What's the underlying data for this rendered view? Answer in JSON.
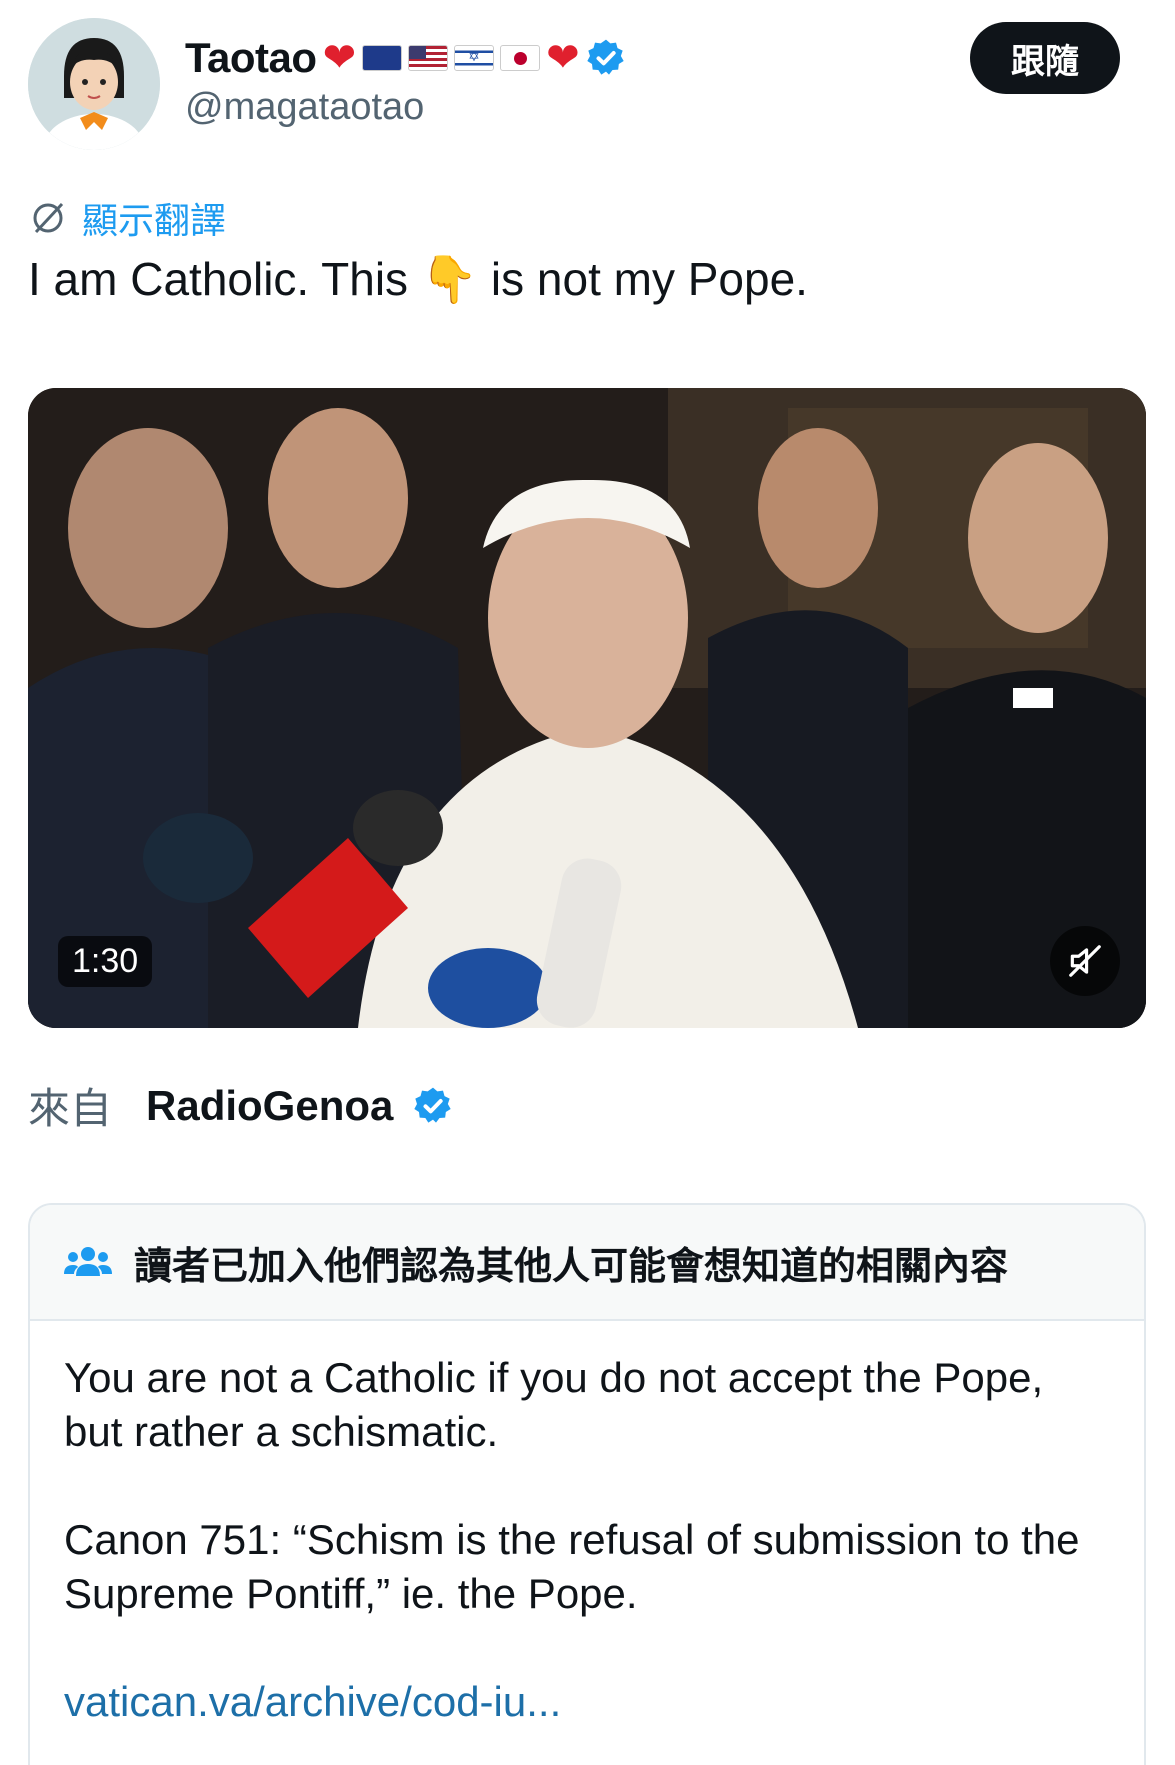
{
  "author": {
    "display_name": "Taotao",
    "handle": "@magataotao",
    "flags": [
      "australia-flag",
      "us-flag",
      "israel-flag",
      "japan-flag"
    ]
  },
  "follow_label": "跟隨",
  "translate_label": "顯示翻譯",
  "tweet_text_before": "I am Catholic. This ",
  "tweet_emoji": "👇",
  "tweet_text_after": " is not my Pope.",
  "video": {
    "duration": "1:30"
  },
  "source": {
    "label": "來自",
    "name": "RadioGenoa"
  },
  "note": {
    "header": "讀者已加入他們認為其他人可能會想知道的相關內容",
    "paragraph1": "You are not a Catholic if you do not accept the Pope, but rather a schismatic.",
    "paragraph2": "Canon 751: “Schism is the refusal of submission to the Supreme Pontiff,” ie. the Pope.",
    "link": "vatican.va/archive/cod-iu..."
  },
  "colors": {
    "accent": "#1d9bf0",
    "heart": "#e0202e",
    "follow_bg": "#0f1419"
  }
}
